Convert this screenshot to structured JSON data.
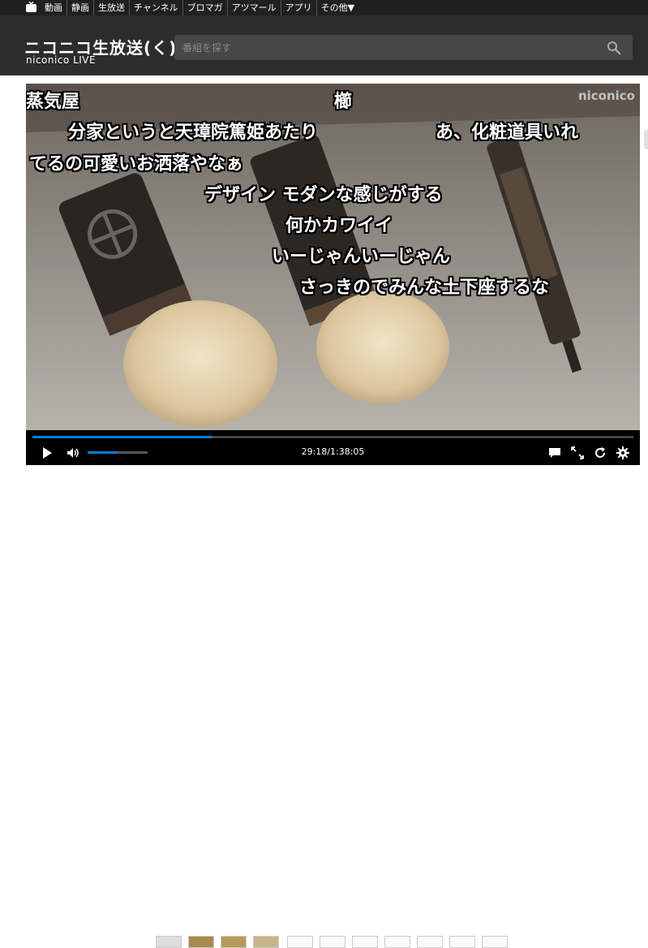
{
  "topnav": {
    "items": [
      "動画",
      "静画",
      "生放送",
      "チャンネル",
      "ブロマガ",
      "アツマール",
      "アプリ",
      "その他▼"
    ]
  },
  "header": {
    "logo_main": "ニコニコ生放送(く)",
    "logo_sub": "niconico LIVE",
    "search_placeholder": "番組を探す"
  },
  "player": {
    "watermark": "niconico",
    "comments": [
      "蒸気屋",
      "櫛",
      "分家というと天璋院篤姫あたり",
      "あ、化粧道具いれ",
      "てるの可愛いお洒落やなぁ",
      "デザイン モダンな感じがする",
      "何かカワイイ",
      "いーじゃんいーじゃん",
      "さっきのでみんな土下座するな"
    ],
    "time": "29:18/1:38:05",
    "progress": 0.3,
    "volume": 0.5
  }
}
